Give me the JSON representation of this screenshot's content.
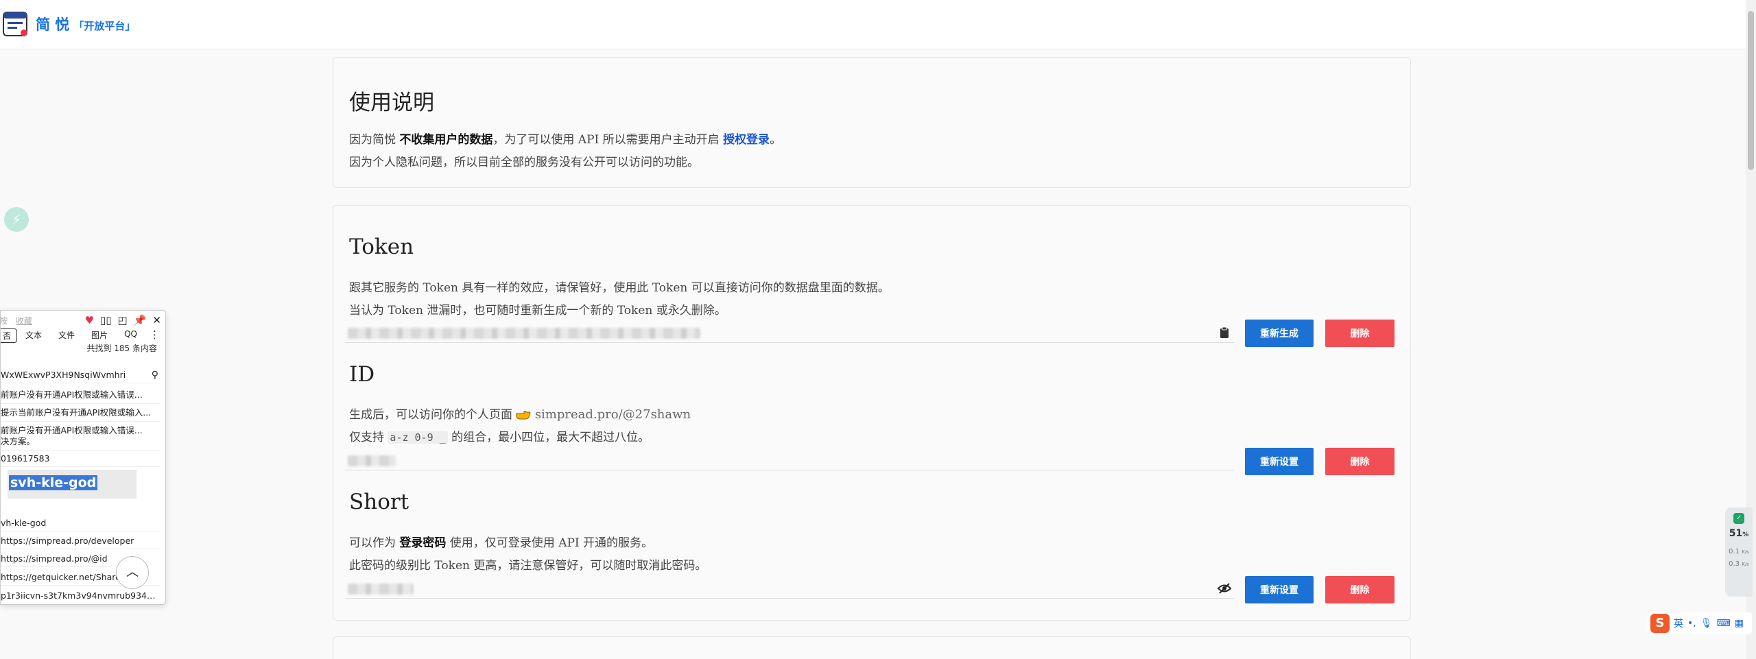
{
  "header": {
    "brand": "简 悦",
    "brand_sub": "「开放平台」"
  },
  "usage": {
    "title": "使用说明",
    "line1_a": "因为简悦 ",
    "line1_b": "不收集用户的数据",
    "line1_c": "，为了可以使用 API 所以需要用户主动开启 ",
    "line1_link": "授权登录",
    "line1_d": "。",
    "line2": "因为个人隐私问题，所以目前全部的服务没有公开可以访问的功能。"
  },
  "token": {
    "title": "Token",
    "line1": "跟其它服务的 Token 具有一样的效应，请保管好，使用此 Token 可以直接访问你的数据盘里面的数据。",
    "line2": "当认为 Token 泄漏时，也可随时重新生成一个新的 Token 或永久删除。",
    "regen_label": "重新生成",
    "delete_label": "删除"
  },
  "id": {
    "title": "ID",
    "line1_a": "生成后，可以访问你的个人页面 ",
    "line1_link": "simpread.pro/@27shawn",
    "line2_a": "仅支持 ",
    "line2_code": "a-z 0-9 _",
    "line2_b": " 的组合，最小四位，最大不超过八位。",
    "reset_label": "重新设置",
    "delete_label": "删除"
  },
  "short": {
    "title": "Short",
    "line1_a": "可以作为 ",
    "line1_b": "登录密码",
    "line1_c": " 使用，仅可登录使用 API 开通的服务。",
    "line2": "此密码的级别比 Token 更高，请注意保管好，可以随时取消此密码。",
    "reset_label": "重新设置",
    "delete_label": "删除"
  },
  "clipboard": {
    "search_a": "按",
    "search_placeholder": "收藏",
    "tabs": [
      "否",
      "文本",
      "文件",
      "图片",
      "QQ"
    ],
    "count": "共找到 185 条内容",
    "items": [
      "WxWExwvP3XH9NsqiWvmhri",
      "前账户没有开通API权限或输入错误...",
      "提示当前账户没有开通API权限或输入...",
      "前账户没有开通API权限或输入错误...",
      "决方案。",
      "019617583",
      "vh-kle-god",
      "https://simpread.pro/developer",
      "https://simpread.pro/@id",
      "https://getquicker.net/Shared...",
      "p1r3iicvn-s3t7km3v94nvmrub9346..."
    ],
    "selected": "svh-kle-god"
  },
  "widget": {
    "percent": "51",
    "percent_unit": "%",
    "up": "0.1",
    "down": "0.3",
    "unit": "K/s"
  },
  "ime": {
    "logo": "S",
    "mode": "英"
  }
}
